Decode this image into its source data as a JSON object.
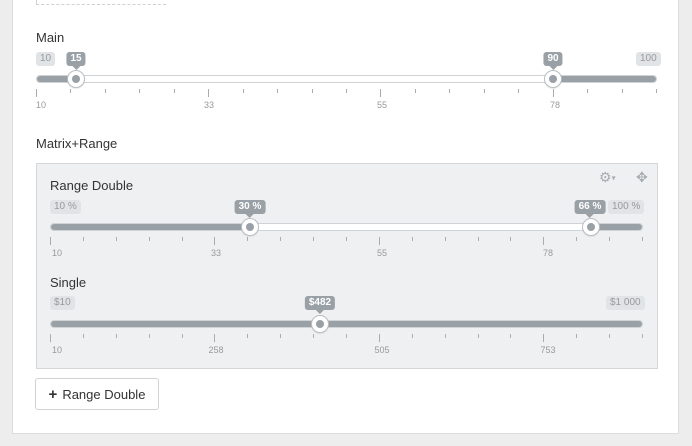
{
  "main": {
    "label": "Main",
    "min_label": "10",
    "max_label": "100",
    "from_label": "15",
    "to_label": "90",
    "from": 15,
    "to": 90,
    "min": 10,
    "max": 100,
    "tick_labels": [
      "10",
      "33",
      "55",
      "78"
    ]
  },
  "matrix": {
    "label": "Matrix+Range",
    "toolbar": {
      "settings_icon": "gear-icon",
      "move_icon": "move-icon"
    },
    "range_double": {
      "label": "Range Double",
      "min_label": "10 %",
      "max_label": "100 %",
      "from_label": "30 %",
      "to_label": "66 %",
      "from": 30,
      "to": 66,
      "tick_labels": [
        "10",
        "33",
        "55",
        "78"
      ]
    },
    "single": {
      "label": "Single",
      "min_label": "$10",
      "max_label": "$1 000",
      "value_label": "$482",
      "value": 482,
      "tick_labels": [
        "10",
        "258",
        "505",
        "753"
      ]
    }
  },
  "add_button": {
    "label": "Range Double",
    "icon": "plus-icon"
  }
}
